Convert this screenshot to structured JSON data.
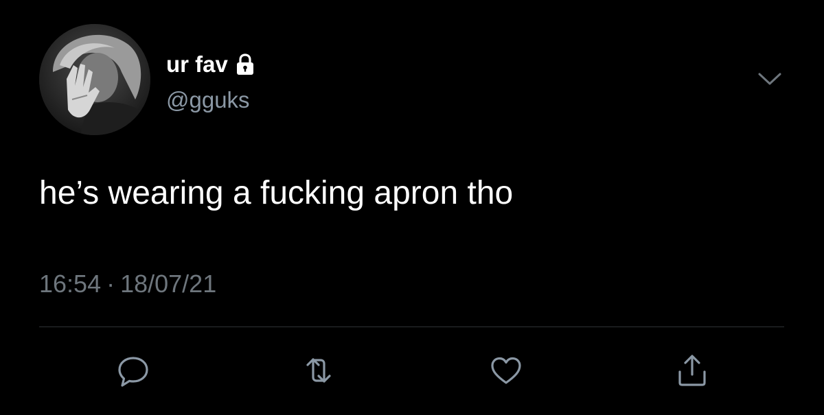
{
  "tweet": {
    "display_name": "ur fav",
    "handle": "@gguks",
    "protected": true,
    "text": "he’s wearing a fucking apron tho",
    "time": "16:54",
    "separator": "·",
    "date": "18/07/21"
  },
  "icons": {
    "lock": "lock-icon",
    "more": "chevron-down-icon",
    "reply": "reply-icon",
    "retweet": "retweet-icon",
    "like": "heart-icon",
    "share": "share-icon"
  },
  "colors": {
    "background": "#000000",
    "text": "#ffffff",
    "secondary_text": "#8b98a5",
    "muted_text": "#6e767d",
    "divider": "#2f3336",
    "icon": "#8b98a5"
  }
}
